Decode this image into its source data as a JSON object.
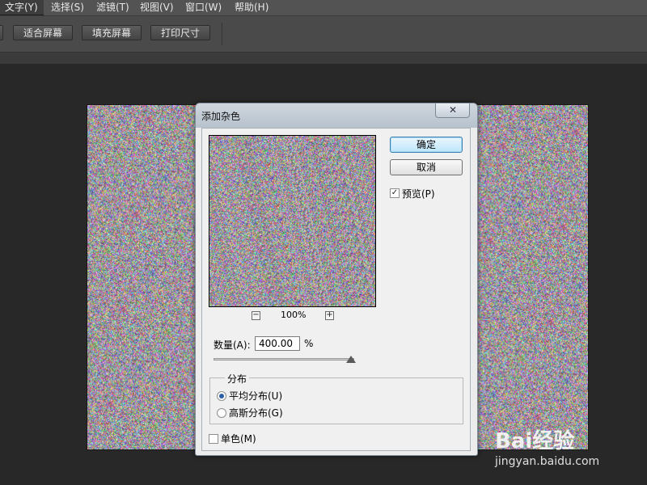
{
  "menubar": {
    "items": [
      "文字(Y)",
      "选择(S)",
      "滤镜(T)",
      "视图(V)",
      "窗口(W)",
      "帮助(H)"
    ]
  },
  "optionbar": {
    "buttons": [
      "适合屏幕",
      "填充屏幕",
      "打印尺寸"
    ]
  },
  "dialog": {
    "title": "添加杂色",
    "close_glyph": "✕",
    "ok_label": "确定",
    "cancel_label": "取消",
    "preview_label": "预览(P)",
    "preview_checked": true,
    "zoom_minus": "−",
    "zoom_plus": "+",
    "zoom_level": "100%",
    "amount_label": "数量(A):",
    "amount_value": "400.00",
    "amount_unit": "%",
    "distribution_group": "分布",
    "uniform_label": "平均分布(U)",
    "uniform_checked": true,
    "gaussian_label": "高斯分布(G)",
    "gaussian_checked": false,
    "monochromatic_label": "单色(M)",
    "monochromatic_checked": false
  },
  "watermark": {
    "brand": "Bai经验",
    "url": "jingyan.baidu.com"
  },
  "colors": {
    "menubar_bg": "#535353",
    "workspace_bg": "#282828",
    "dialog_bg": "#f0f0f0",
    "default_button": "#bee6fd"
  }
}
